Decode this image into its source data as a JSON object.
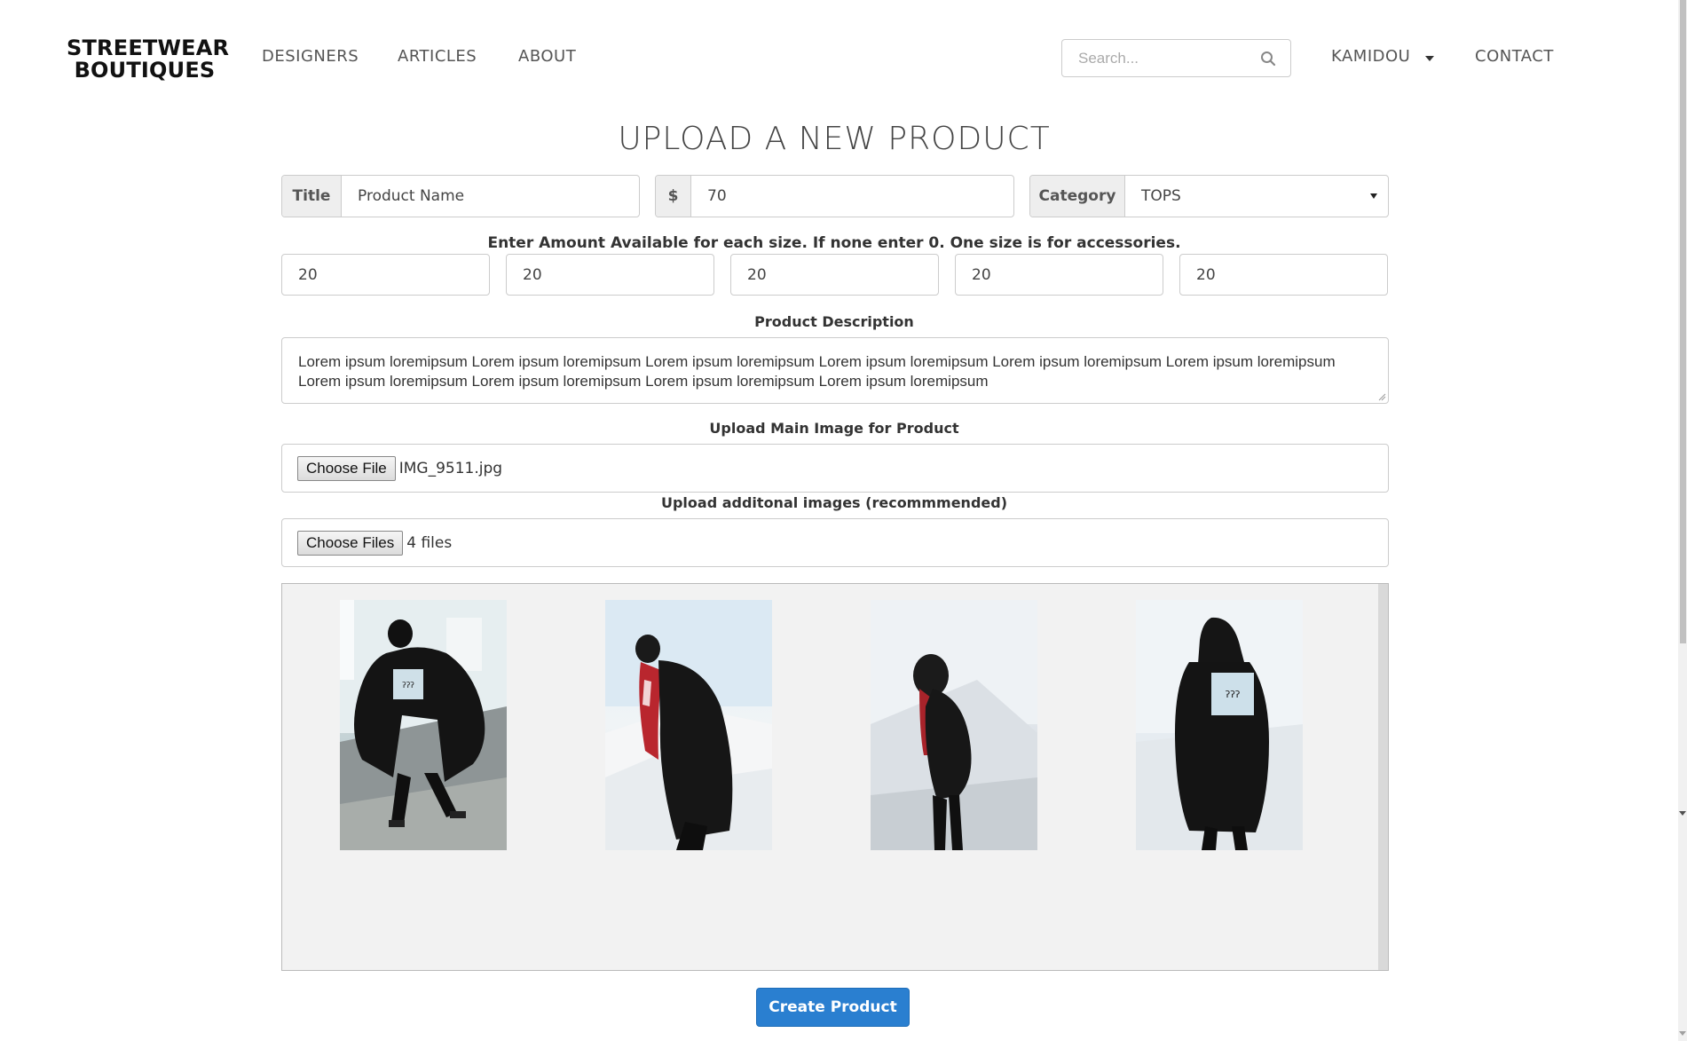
{
  "brand": {
    "line1": "STREETWEAR",
    "line2": "BOUTIQUES"
  },
  "nav": {
    "links": [
      "DESIGNERS",
      "ARTICLES",
      "ABOUT"
    ],
    "search_placeholder": "Search...",
    "user": "KAMIDOU",
    "contact": "CONTACT"
  },
  "page": {
    "title": "UPLOAD A NEW PRODUCT"
  },
  "form": {
    "title_addon": "Title",
    "title_value": "Product Name",
    "price_addon": "$",
    "price_value": "70",
    "category_addon": "Category",
    "category_value": "TOPS",
    "sizes_label": "Enter Amount Available for each size. If none enter 0. One size is for accessories.",
    "sizes": [
      "20",
      "20",
      "20",
      "20",
      "20"
    ],
    "description_label": "Product Description",
    "description_value": "Lorem ipsum loremipsum Lorem ipsum loremipsum Lorem ipsum loremipsum Lorem ipsum loremipsum Lorem ipsum loremipsum Lorem ipsum loremipsum Lorem ipsum loremipsum Lorem ipsum loremipsum Lorem ipsum loremipsum Lorem ipsum loremipsum",
    "main_image_label": "Upload Main Image for Product",
    "main_image_button": "Choose File",
    "main_image_file": "IMG_9511.jpg",
    "additional_label": "Upload additonal images (recommmended)",
    "additional_button": "Choose Files",
    "additional_files": "4 files",
    "thumb_tag": "ʔʔʔ",
    "submit": "Create Product"
  },
  "colors": {
    "primary": "#2a7fd0",
    "addon_bg": "#eeeeee",
    "preview_bg": "#f2f2f2"
  }
}
